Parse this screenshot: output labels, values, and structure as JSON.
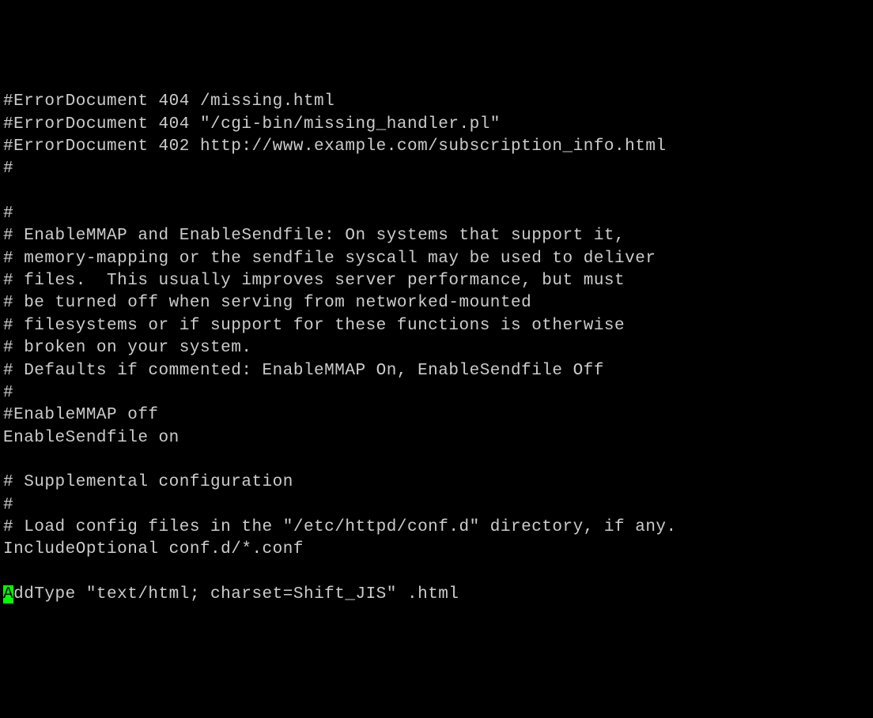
{
  "editor": {
    "lines": [
      "#ErrorDocument 404 /missing.html",
      "#ErrorDocument 404 \"/cgi-bin/missing_handler.pl\"",
      "#ErrorDocument 402 http://www.example.com/subscription_info.html",
      "#",
      "",
      "#",
      "# EnableMMAP and EnableSendfile: On systems that support it,",
      "# memory-mapping or the sendfile syscall may be used to deliver",
      "# files.  This usually improves server performance, but must",
      "# be turned off when serving from networked-mounted",
      "# filesystems or if support for these functions is otherwise",
      "# broken on your system.",
      "# Defaults if commented: EnableMMAP On, EnableSendfile Off",
      "#",
      "#EnableMMAP off",
      "EnableSendfile on",
      "",
      "# Supplemental configuration",
      "#",
      "# Load config files in the \"/etc/httpd/conf.d\" directory, if any.",
      "IncludeOptional conf.d/*.conf",
      ""
    ],
    "cursor_line": {
      "cursor_char": "A",
      "rest": "ddType \"text/html; charset=Shift_JIS\" .html"
    }
  }
}
